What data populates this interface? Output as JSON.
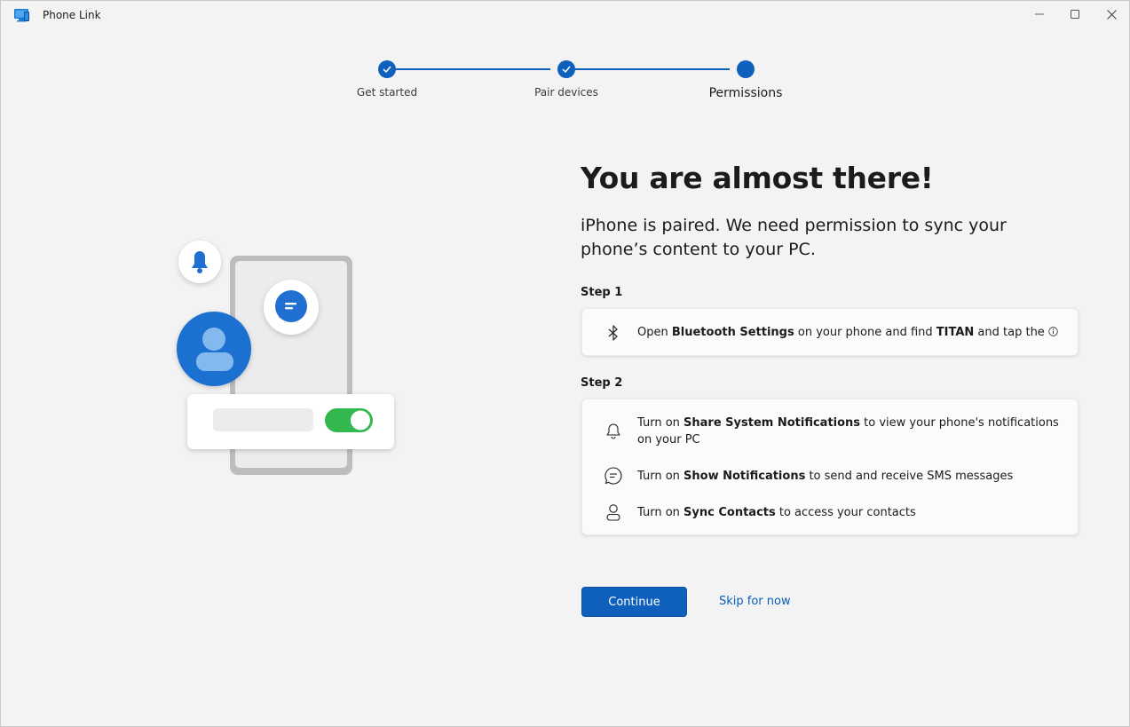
{
  "window": {
    "title": "Phone Link"
  },
  "stepper": {
    "steps": [
      {
        "label": "Get started"
      },
      {
        "label": "Pair devices"
      },
      {
        "label": "Permissions"
      }
    ]
  },
  "main": {
    "heading": "You are almost there!",
    "subtitle": "iPhone is paired. We need permission to sync your phone’s content to your PC.",
    "step1": {
      "title": "Step 1",
      "item": {
        "t1": "Open ",
        "b1": "Bluetooth Settings",
        "t2": " on your phone and find ",
        "b2": "TITAN",
        "t3": " and tap the ",
        "icon": "info-icon"
      }
    },
    "step2": {
      "title": "Step 2",
      "items": [
        {
          "icon": "bell-icon",
          "t1": "Turn on ",
          "b1": "Share System Notifications",
          "t2": " to view your phone's notifications on your PC"
        },
        {
          "icon": "chat-icon",
          "t1": "Turn on ",
          "b1": "Show Notifications",
          "t2": " to send and receive SMS messages"
        },
        {
          "icon": "person-icon",
          "t1": "Turn on ",
          "b1": "Sync Contacts",
          "t2": " to access your contacts"
        }
      ]
    },
    "buttons": {
      "continue": "Continue",
      "skip": "Skip for now"
    }
  },
  "colors": {
    "accent": "#0f5fbd",
    "toggle_on": "#32b84e",
    "background": "#f3f3f3"
  }
}
